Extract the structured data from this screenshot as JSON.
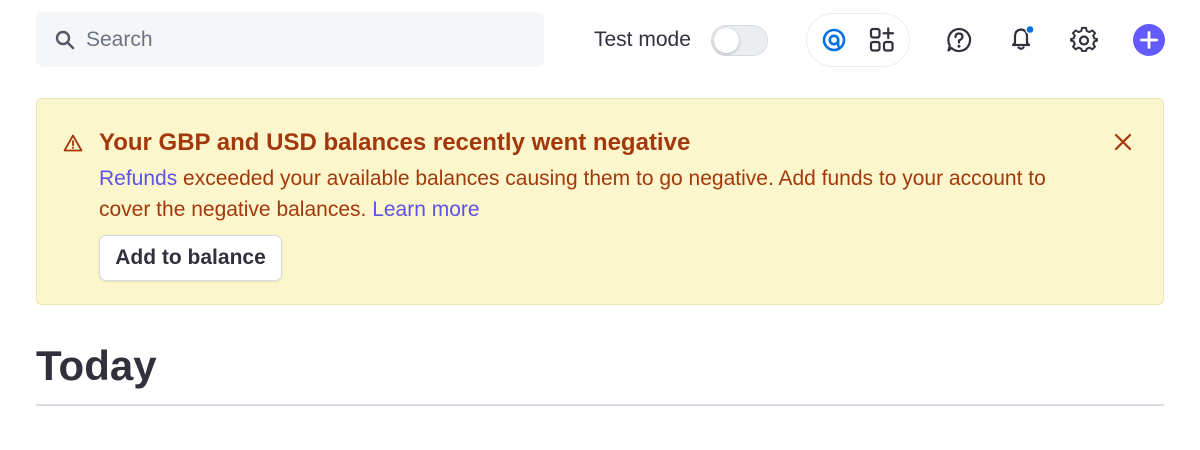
{
  "search": {
    "placeholder": "Search"
  },
  "header": {
    "test_mode_label": "Test mode",
    "test_mode_enabled": false,
    "icons": [
      "search-icon",
      "radar-icon",
      "apps-icon",
      "help-icon",
      "notification-bell-icon",
      "gear-icon",
      "add-plus-icon"
    ],
    "notification_dot_color": "#0570de",
    "plus_color": "#635bff",
    "radar_color": "#0570de"
  },
  "banner": {
    "title": "Your GBP and USD balances recently went negative",
    "body_link_refunds": "Refunds",
    "body_text": " exceeded your available balances causing them to go negative. Add funds to your account to cover the negative balances. ",
    "body_link_learn": "Learn more",
    "button_label": "Add to balance",
    "background": "#fbf6cb",
    "text_color": "#a4380d",
    "link_color": "#5e52e8"
  },
  "main": {
    "title": "Today"
  }
}
